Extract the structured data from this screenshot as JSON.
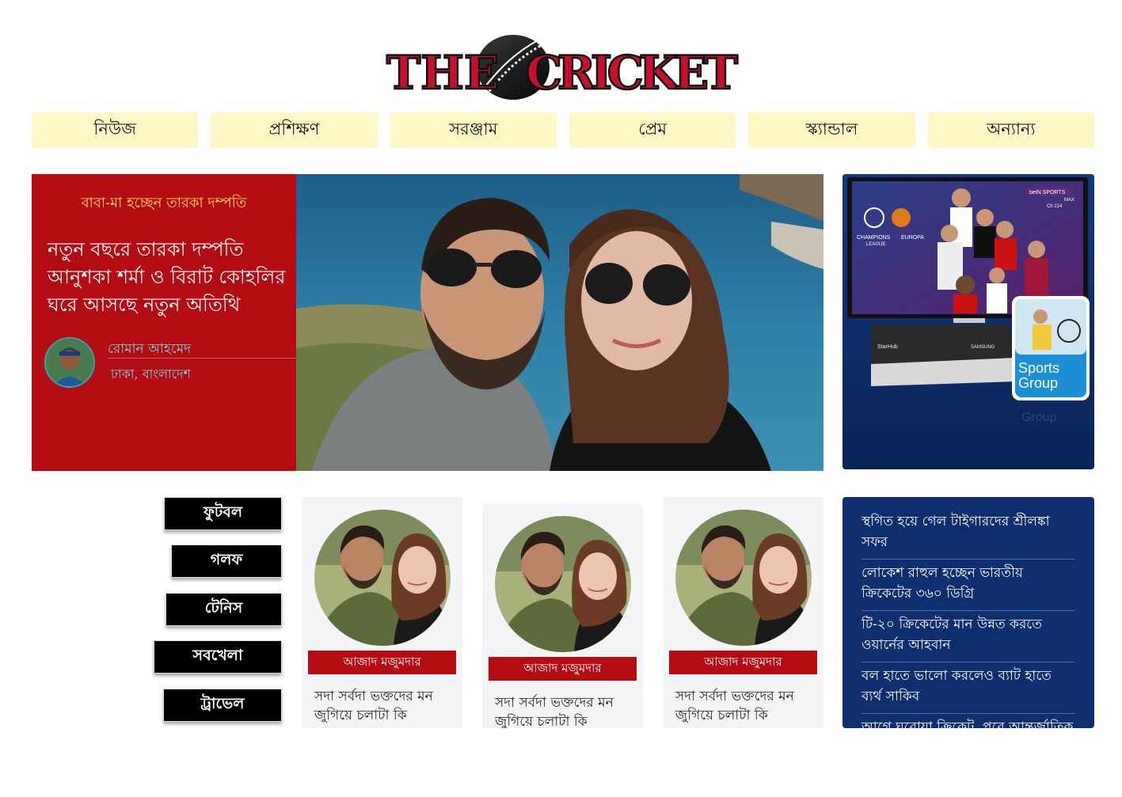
{
  "logo": {
    "text_left": "THE",
    "text_right": "CRICKET"
  },
  "nav": {
    "items": [
      "নিউজ",
      "প্রশিক্ষণ",
      "সরঞ্জাম",
      "প্রেম",
      "স্ক্যান্ডাল",
      "অন্যান্য"
    ]
  },
  "hero": {
    "kicker": "বাবা-মা হচ্ছেন তারকা দম্পতি",
    "title": "নতুন বছরে তারকা দম্পতি আনুশকা শর্মা ও বিরাট কোহলির ঘরে আসছে নতুন অতিথি",
    "author_name": "রোমান আহমেদ",
    "author_location": "ঢাকা, বাংলাদেশ"
  },
  "ad": {
    "brand": "Sports Group",
    "logo_line1": "CHAMPIONS",
    "logo_line2": "LEAGUE",
    "logo_line3": "EUROPA",
    "channel": "beIN SPORTS",
    "channel_sub": "MAX",
    "channel_no": "Ch 214",
    "box_left": "StarHub",
    "box_right": "SAMSUNG"
  },
  "sports": {
    "items": [
      "ফুটবল",
      "গলফ",
      "টেনিস",
      "সবখেলা",
      "ট্রাভেল"
    ]
  },
  "cards": [
    {
      "byline": "আজাদ মজুমদার",
      "text": "সদা সর্বদা ভক্তদের মন জুগিয়ে চলাটা কি"
    },
    {
      "byline": "আজাদ মজুমদার",
      "text": "সদা সর্বদা ভক্তদের মন জুগিয়ে চলাটা কি"
    },
    {
      "byline": "আজাদ মজুমদার",
      "text": "সদা সর্বদা ভক্তদের মন জুগিয়ে চলাটা কি"
    }
  ],
  "headlines": [
    "স্থগিত হয়ে গেল টাইগারদের শ্রীলঙ্কা সফর",
    "লোকেশ রাহুল হচ্ছেন ভারতীয় ক্রিকেটের ৩৬০ ডিগ্রি",
    "টি-২০ ক্রিকেটের মান উন্নত করতে ওয়ার্নের আহবান",
    "বল হাতে ভালো করলেও ব্যাট হাতে ব্যর্থ সাকিব",
    "আগে ঘরোয়া ক্রিকেট, পরে আন্তর্জাতিক"
  ],
  "colors": {
    "brand_red": "#b30d13",
    "nav_bg": "#fff8c4",
    "navy": "#0d2f6e",
    "kicker_yellow": "#ffe14a"
  }
}
